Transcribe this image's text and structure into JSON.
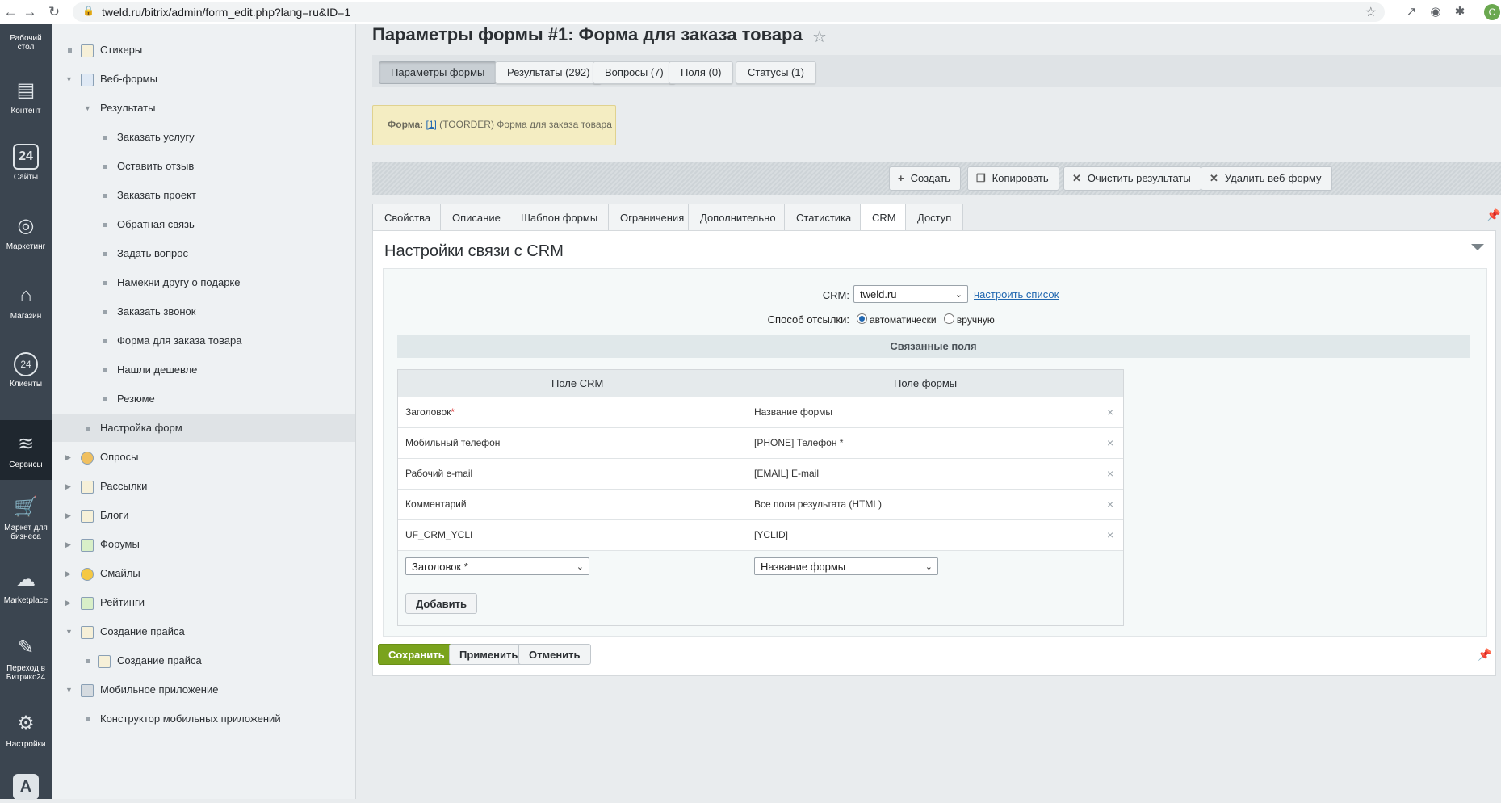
{
  "browser": {
    "url": "tweld.ru/bitrix/admin/form_edit.php?lang=ru&ID=1",
    "profile_initial": "C"
  },
  "left_panel": {
    "items": [
      {
        "label": "Рабочий стол",
        "icon": "desktop-icon"
      },
      {
        "label": "Контент",
        "icon": "document-icon"
      },
      {
        "label": "Сайты",
        "icon": "calendar-24-icon"
      },
      {
        "label": "Маркетинг",
        "icon": "target-icon"
      },
      {
        "label": "Магазин",
        "icon": "basket-icon"
      },
      {
        "label": "Клиенты",
        "icon": "clients-24-icon"
      },
      {
        "label": "Сервисы",
        "icon": "layers-icon"
      },
      {
        "label": "Маркет для бизнеса",
        "icon": "cart-icon"
      },
      {
        "label": "Marketplace",
        "icon": "cloud-download-icon"
      },
      {
        "label": "Переход в Битрикс24",
        "icon": "sparkle-icon"
      },
      {
        "label": "Настройки",
        "icon": "gear-icon"
      },
      {
        "label": "",
        "icon": "letter-a-icon"
      }
    ]
  },
  "tree": {
    "items": [
      {
        "label": "Стикеры"
      },
      {
        "label": "Веб-формы"
      },
      {
        "label": "Результаты"
      },
      {
        "label": "Заказать услугу"
      },
      {
        "label": "Оставить отзыв"
      },
      {
        "label": "Заказать проект"
      },
      {
        "label": "Обратная связь"
      },
      {
        "label": "Задать вопрос"
      },
      {
        "label": "Намекни другу о подарке"
      },
      {
        "label": "Заказать звонок"
      },
      {
        "label": "Форма для заказа товара"
      },
      {
        "label": "Нашли дешевле"
      },
      {
        "label": "Резюме"
      },
      {
        "label": "Настройка форм"
      },
      {
        "label": "Опросы"
      },
      {
        "label": "Рассылки"
      },
      {
        "label": "Блоги"
      },
      {
        "label": "Форумы"
      },
      {
        "label": "Смайлы"
      },
      {
        "label": "Рейтинги"
      },
      {
        "label": "Создание прайса"
      },
      {
        "label": "Создание прайса"
      },
      {
        "label": "Мобильное приложение"
      },
      {
        "label": "Конструктор мобильных приложений"
      }
    ]
  },
  "page": {
    "title": "Параметры формы #1: Форма для заказа товара"
  },
  "top_tabs": [
    {
      "label": "Параметры формы"
    },
    {
      "label": "Результаты (292)"
    },
    {
      "label": "Вопросы (7)"
    },
    {
      "label": "Поля (0)"
    },
    {
      "label": "Статусы (1)"
    }
  ],
  "notice": {
    "label": "Форма:",
    "link": "[1]",
    "text": "(TOORDER) Форма для заказа товара"
  },
  "actions": {
    "create": "Создать",
    "copy": "Копировать",
    "clear": "Очистить результаты",
    "delete": "Удалить веб-форму"
  },
  "tabs": [
    {
      "label": "Свойства"
    },
    {
      "label": "Описание"
    },
    {
      "label": "Шаблон формы"
    },
    {
      "label": "Ограничения"
    },
    {
      "label": "Дополнительно"
    },
    {
      "label": "Статистика"
    },
    {
      "label": "CRM"
    },
    {
      "label": "Доступ"
    }
  ],
  "crm": {
    "panel_title": "Настройки связи с CRM",
    "crm_label": "CRM:",
    "crm_value": "tweld.ru",
    "configure_link": "настроить список",
    "send_label": "Способ отсылки:",
    "send_auto": "автоматически",
    "send_manual": "вручную",
    "linked_header": "Связанные поля",
    "col_crm": "Поле CRM",
    "col_form": "Поле формы",
    "rows": [
      {
        "crm": "Заголовок",
        "required": "*",
        "form": "Название формы"
      },
      {
        "crm": "Мобильный телефон",
        "required": "",
        "form": "[PHONE] Телефон *"
      },
      {
        "crm": "Рабочий e-mail",
        "required": "",
        "form": "[EMAIL] E-mail"
      },
      {
        "crm": "Комментарий",
        "required": "",
        "form": "Все поля результата (HTML)"
      },
      {
        "crm": "UF_CRM_YCLI",
        "required": "",
        "form": "[YCLID]"
      }
    ],
    "remove_glyph": "×",
    "new_crm_select": "Заголовок *",
    "new_form_select": "Название формы",
    "add_button": "Добавить"
  },
  "footer": {
    "save": "Сохранить",
    "apply": "Применить",
    "cancel": "Отменить"
  }
}
